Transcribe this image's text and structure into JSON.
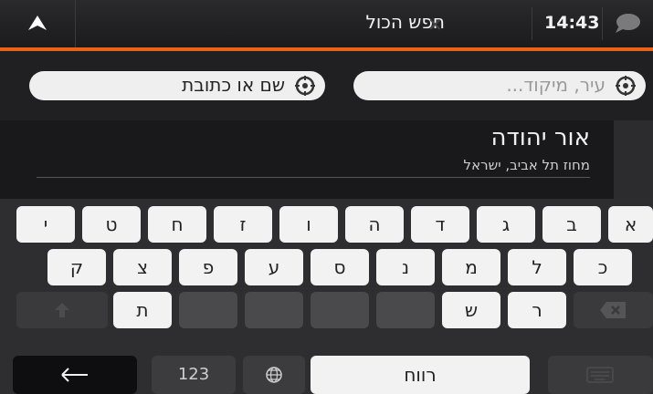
{
  "header": {
    "back_icon": "up-triangle-icon",
    "title": "חפש הכול",
    "clear_icon": "x-icon",
    "time": "14:43",
    "message_icon": "speech-bubble-icon",
    "accent_color": "#e8621c"
  },
  "search": {
    "left_field_label": "שם או כתובת",
    "right_field_placeholder": "עיר, מיקוד..."
  },
  "result": {
    "name": "אור יהודה",
    "detail": "מחוז תל אביב, ישראל"
  },
  "keyboard": {
    "row1": [
      "י",
      "ט",
      "ח",
      "ז",
      "ו",
      "ה",
      "ד",
      "ג",
      "ב",
      "א"
    ],
    "row2": [
      "ק",
      "צ",
      "פ",
      "ע",
      "ס",
      "נ",
      "מ",
      "ל",
      "כ"
    ],
    "row3": [
      "ת",
      "ש",
      "ר"
    ],
    "numbers_label": "123",
    "space_label": "רווח",
    "back_icon": "left-arrow-icon",
    "globe_icon": "globe-icon",
    "shift_icon": "shift-arrow-icon",
    "backspace_icon": "backspace-icon",
    "hide_icon": "keyboard-icon"
  }
}
